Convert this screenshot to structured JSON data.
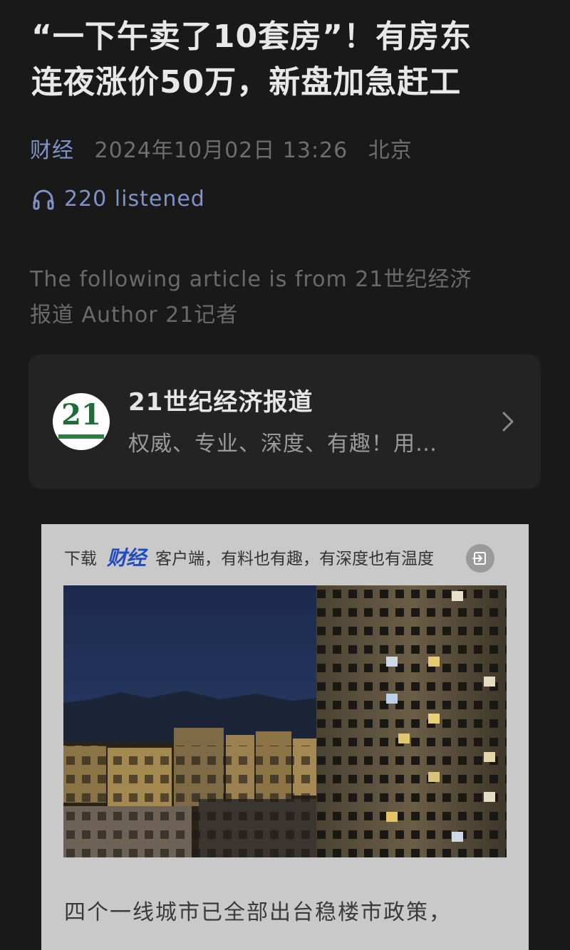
{
  "article": {
    "title_line1": "“一下午卖了10套房”！有房东",
    "title_line2": "连夜涨价50万，新盘加急赶工",
    "source": "财经",
    "date": "2024年10月02日 13:26",
    "location": "北京",
    "listen_count": "220 listened",
    "source_note_line1": "The following article is from 21世纪经济",
    "source_note_line2": "报道 Author 21记者"
  },
  "account_card": {
    "logo_text": "21",
    "name": "21世纪经济报道",
    "description": "权威、专业、深度、有趣！用…"
  },
  "promo": {
    "download": "下载",
    "brand": "财经",
    "slogan": "客户端，有料也有趣，有深度也有温度"
  },
  "excerpt": "四个一线城市已全部出台稳楼市政策，",
  "colors": {
    "background": "#191919",
    "accent": "#7f93c8",
    "card": "#232323",
    "promo_brand": "#1f4cc0"
  },
  "icons": [
    "headphones-icon",
    "chevron-right-icon",
    "exit-icon"
  ]
}
